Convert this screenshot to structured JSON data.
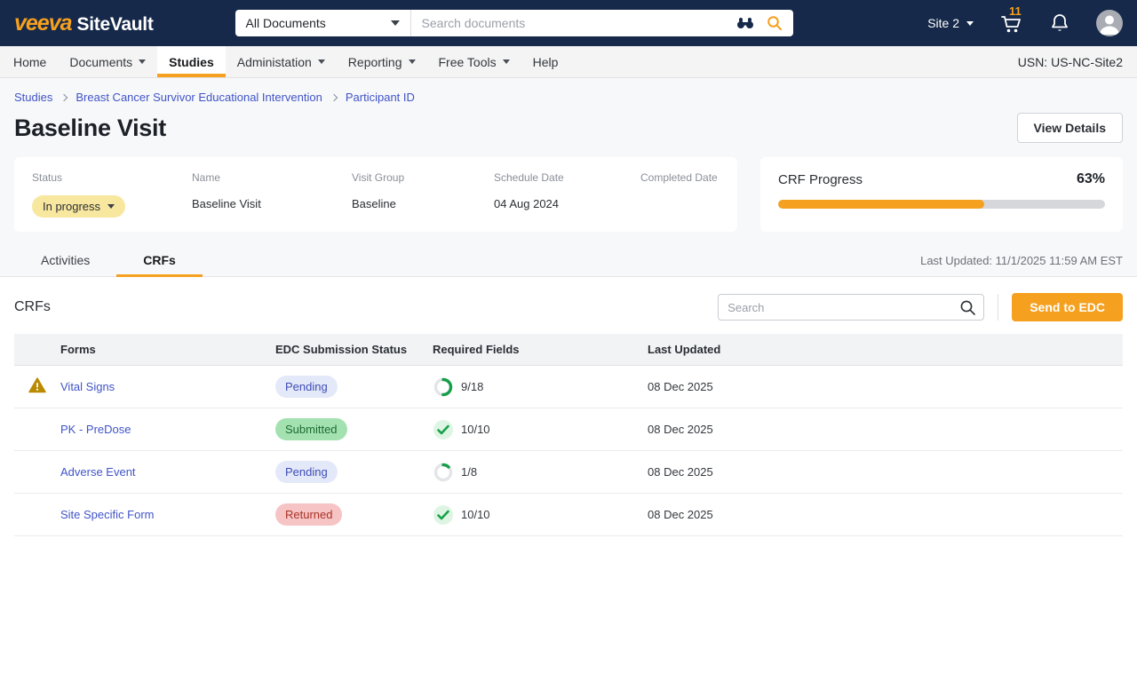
{
  "topbar": {
    "brand": {
      "veeva": "veeva",
      "product": "SiteVault"
    },
    "scope_select": {
      "value": "All Documents"
    },
    "search": {
      "placeholder": "Search documents"
    },
    "site_select": {
      "value": "Site 2"
    },
    "cart_badge": "11"
  },
  "nav": {
    "items": [
      {
        "label": "Home"
      },
      {
        "label": "Documents"
      },
      {
        "label": "Studies"
      },
      {
        "label": "Administation"
      },
      {
        "label": "Reporting"
      },
      {
        "label": "Free Tools"
      },
      {
        "label": "Help"
      }
    ],
    "active_item": "Studies",
    "usn": "USN: US-NC-Site2"
  },
  "breadcrumb": {
    "items": [
      {
        "label": "Studies"
      },
      {
        "label": "Breast Cancer Survivor Educational Intervention"
      },
      {
        "label": "Participant ID"
      }
    ]
  },
  "page": {
    "title": "Baseline Visit",
    "view_details_label": "View Details"
  },
  "visit_card": {
    "fields": [
      {
        "label": "Status",
        "value": "In progress"
      },
      {
        "label": "Name",
        "value": "Baseline Visit"
      },
      {
        "label": "Visit Group",
        "value": "Baseline"
      },
      {
        "label": "Schedule Date",
        "value": "04 Aug 2024"
      },
      {
        "label": "Completed Date",
        "value": ""
      }
    ]
  },
  "progress_card": {
    "label": "CRF Progress",
    "percent": 63,
    "percent_label": "63%"
  },
  "tabs": {
    "items": [
      {
        "label": "Activities"
      },
      {
        "label": "CRFs"
      }
    ],
    "active": "CRFs",
    "last_updated": "Last Updated: 11/1/2025 11:59 AM EST"
  },
  "crfs_section": {
    "heading": "CRFs",
    "search_placeholder": "Search",
    "send_button_label": "Send to EDC"
  },
  "crfs_table": {
    "headers": [
      "Forms",
      "EDC Submission Status",
      "Required Fields",
      "Last Updated"
    ],
    "rows": [
      {
        "warning": true,
        "form": "Vital Signs",
        "status": "Pending",
        "required_done": 9,
        "required_total": 18,
        "required_label": "9/18",
        "last_updated": "08 Dec 2025"
      },
      {
        "warning": false,
        "form": "PK - PreDose",
        "status": "Submitted",
        "required_done": 10,
        "required_total": 10,
        "required_label": "10/10",
        "last_updated": "08 Dec 2025"
      },
      {
        "warning": false,
        "form": "Adverse Event",
        "status": "Pending",
        "required_done": 1,
        "required_total": 8,
        "required_label": "1/8",
        "last_updated": "08 Dec 2025"
      },
      {
        "warning": false,
        "form": "Site Specific Form",
        "status": "Returned",
        "required_done": 10,
        "required_total": 10,
        "required_label": "10/10",
        "last_updated": "08 Dec 2025"
      }
    ]
  },
  "colors": {
    "topbar_bg": "#16294A",
    "accent_orange": "#F5A01E",
    "status_in_progress_bg": "#F8E79E",
    "chip_pending_bg": "#E4E9F9",
    "chip_pending_text": "#3D4DB7",
    "chip_submitted_bg": "#A3E2B0",
    "chip_submitted_text": "#1E6B33",
    "chip_returned_bg": "#F6C4C4",
    "chip_returned_text": "#A93226",
    "progress_green": "#179E4B",
    "warning_amber": "#BA8B00",
    "link_blue": "#4154c8"
  }
}
